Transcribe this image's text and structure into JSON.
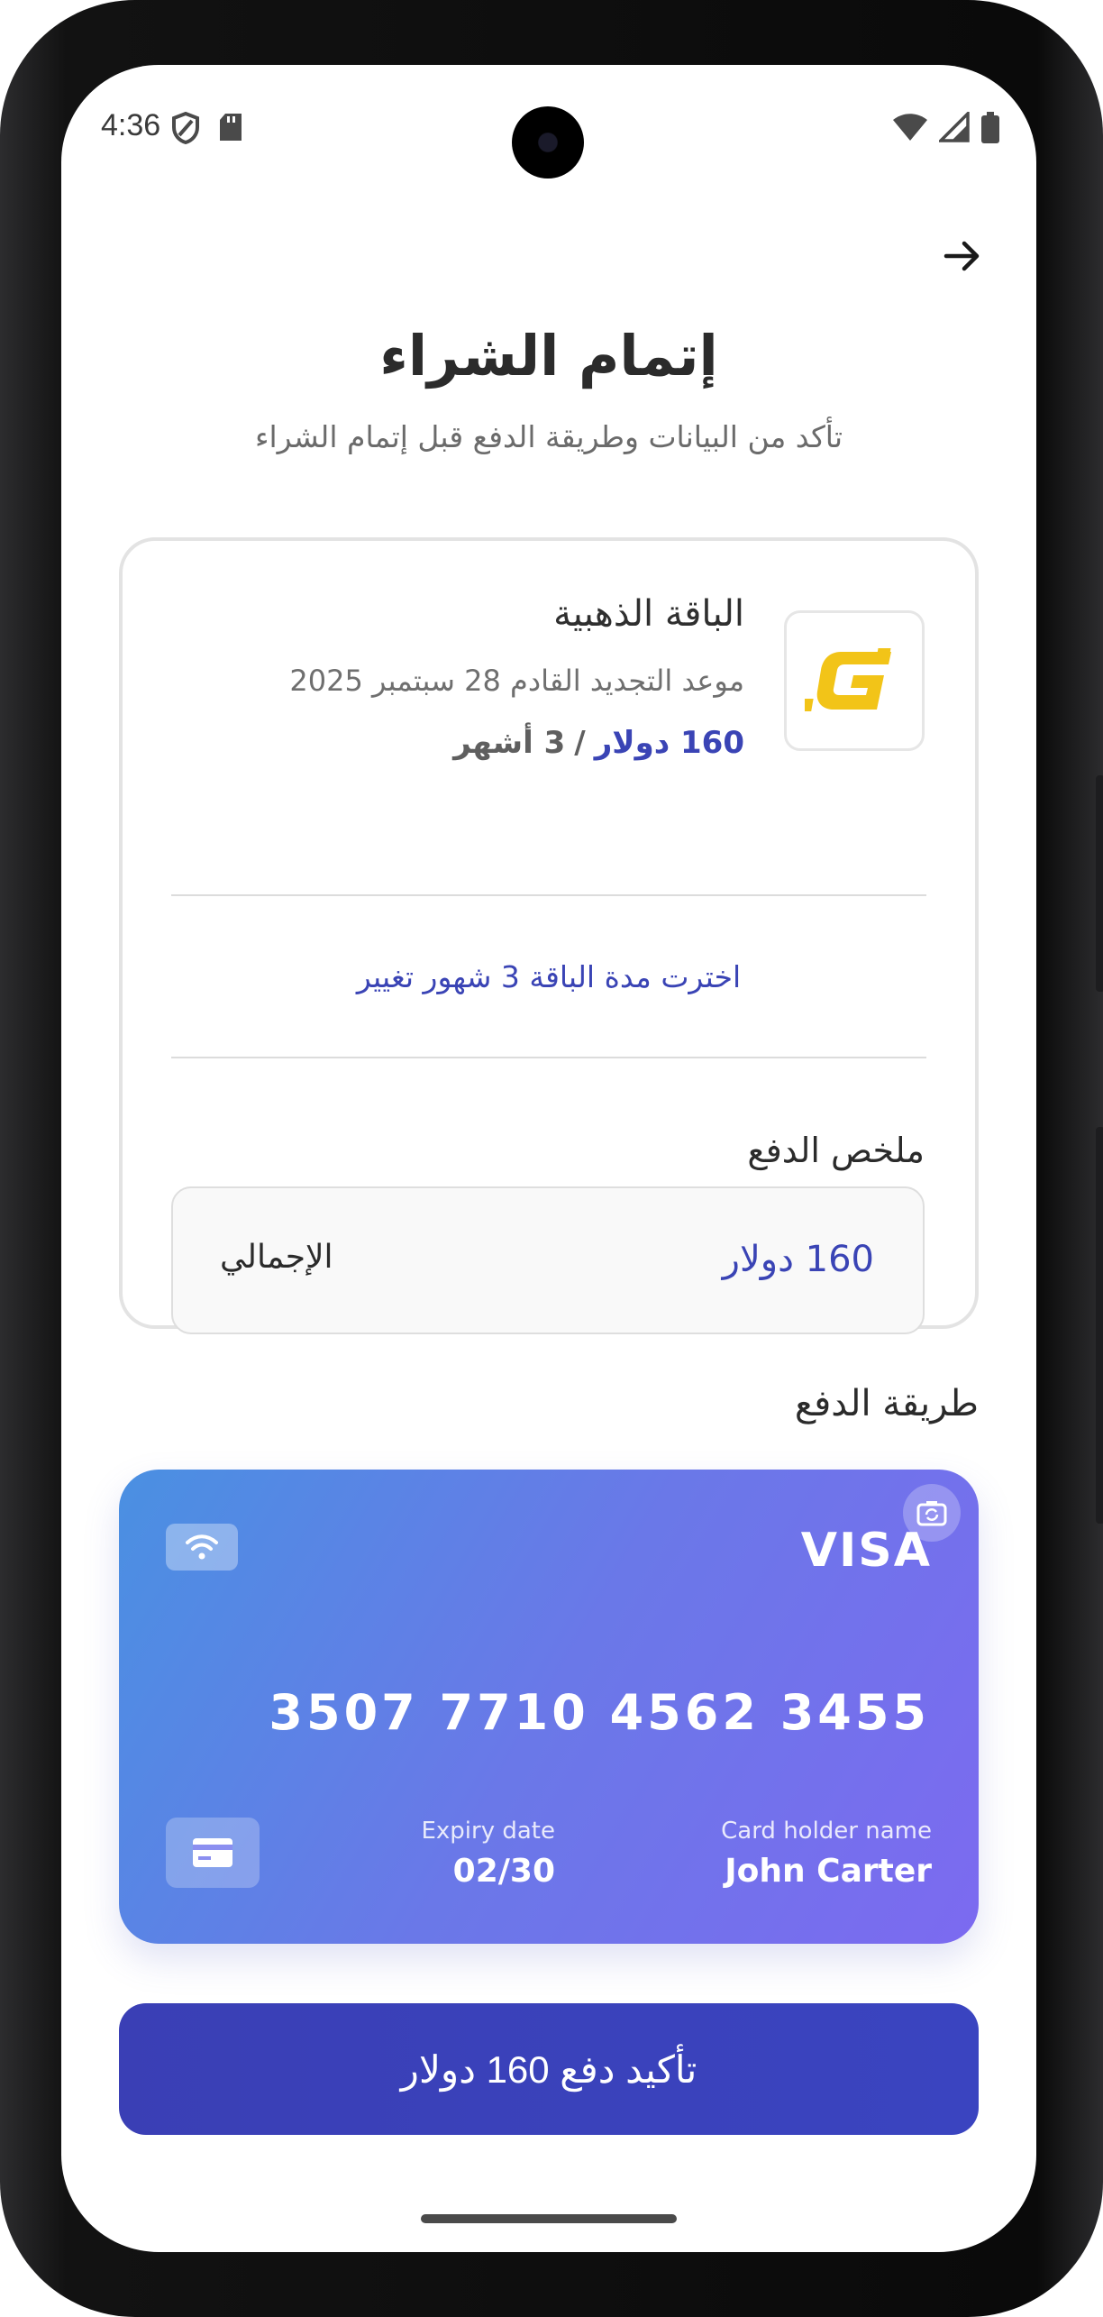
{
  "status_bar": {
    "time": "4:36",
    "left_icons": [
      "shield-icon",
      "sd-card-icon"
    ],
    "right_icons": [
      "wifi-icon",
      "signal-icon",
      "battery-icon"
    ]
  },
  "header": {
    "back_icon": "arrow-right-icon",
    "title": "إتمام الشراء",
    "subtitle": "تأكد من البيانات وطريقة الدفع قبل إتمام الشراء"
  },
  "plan": {
    "logo_icon": "g-logo-icon",
    "name": "الباقة الذهبية",
    "renewal": "موعد التجديد القادم 28 سبتمبر 2025",
    "price": "160 دولار",
    "separator": "/",
    "period": "3 أشهر",
    "duration_note": "اخترت مدة الباقة 3 شهور تغيير"
  },
  "summary": {
    "title": "ملخص الدفع",
    "total_label": "الإجمالي",
    "total_value": "160 دولار"
  },
  "payment_method": {
    "title": "طريقة الدفع",
    "card": {
      "brand": "VISA",
      "number": "3507 7710 4562 3455",
      "expiry_label": "Expiry date",
      "expiry_value": "02/30",
      "holder_label": "Card holder name",
      "holder_value": "John Carter",
      "colors": [
        "#4a90e2",
        "#7c6af0"
      ]
    }
  },
  "confirm_button": {
    "label": "تأكيد دفع 160 دولار"
  },
  "colors": {
    "accent": "#3a44b5",
    "logo": "#f2c418"
  }
}
